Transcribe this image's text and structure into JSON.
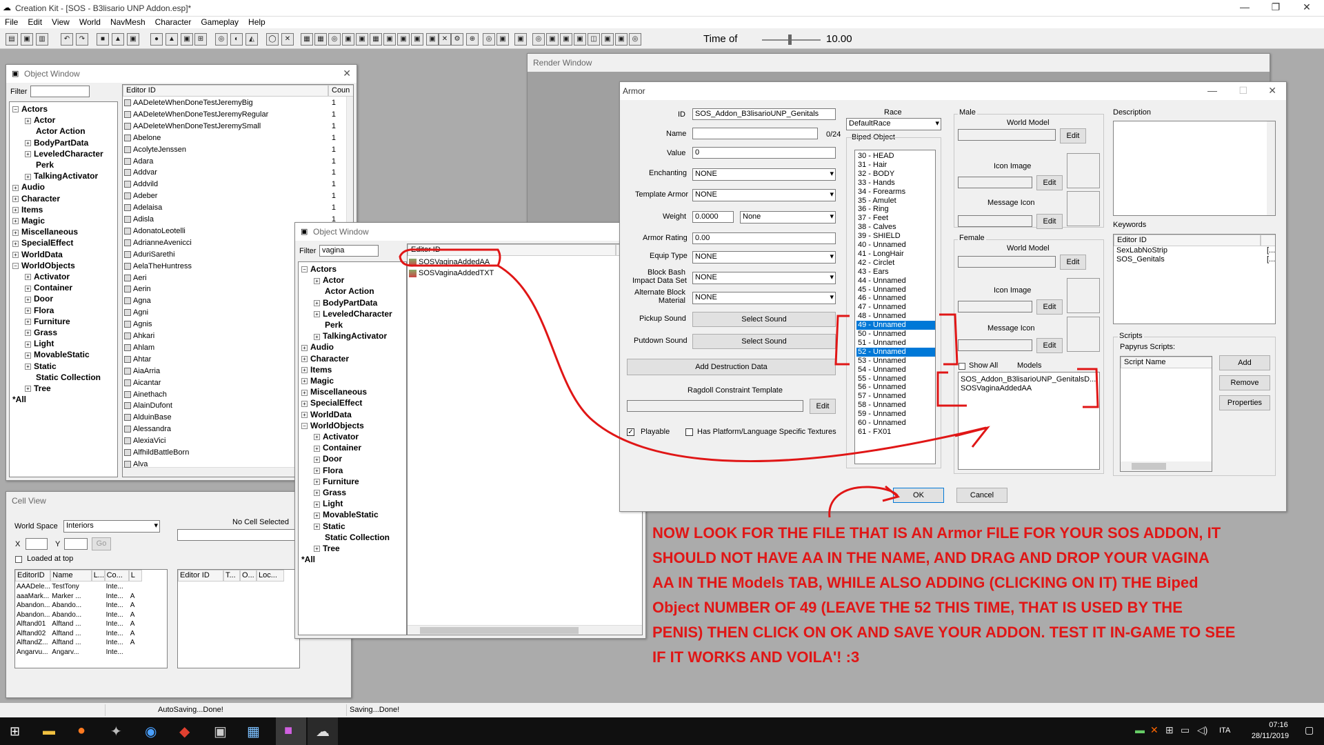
{
  "app": {
    "title": "Creation Kit - [SOS - B3lisario UNP Addon.esp]*",
    "menu": [
      "File",
      "Edit",
      "View",
      "World",
      "NavMesh",
      "Character",
      "Gameplay",
      "Help"
    ],
    "time_label": "Time of",
    "time_value": "10.00"
  },
  "object_window_1": {
    "title": "Object Window",
    "filter_label": "Filter",
    "filter_value": "",
    "col_editor_id": "Editor ID",
    "col_count": "Coun",
    "tree": [
      {
        "label": "Actors",
        "level": 0,
        "sign": "−"
      },
      {
        "label": "Actor",
        "level": 1,
        "sign": "+"
      },
      {
        "label": "Actor Action",
        "level": 1,
        "sign": ""
      },
      {
        "label": "BodyPartData",
        "level": 1,
        "sign": "+"
      },
      {
        "label": "LeveledCharacter",
        "level": 1,
        "sign": "+"
      },
      {
        "label": "Perk",
        "level": 1,
        "sign": ""
      },
      {
        "label": "TalkingActivator",
        "level": 1,
        "sign": "+"
      },
      {
        "label": "Audio",
        "level": 0,
        "sign": "+"
      },
      {
        "label": "Character",
        "level": 0,
        "sign": "+"
      },
      {
        "label": "Items",
        "level": 0,
        "sign": "+"
      },
      {
        "label": "Magic",
        "level": 0,
        "sign": "+"
      },
      {
        "label": "Miscellaneous",
        "level": 0,
        "sign": "+"
      },
      {
        "label": "SpecialEffect",
        "level": 0,
        "sign": "+"
      },
      {
        "label": "WorldData",
        "level": 0,
        "sign": "+"
      },
      {
        "label": "WorldObjects",
        "level": 0,
        "sign": "−"
      },
      {
        "label": "Activator",
        "level": 1,
        "sign": "+"
      },
      {
        "label": "Container",
        "level": 1,
        "sign": "+"
      },
      {
        "label": "Door",
        "level": 1,
        "sign": "+"
      },
      {
        "label": "Flora",
        "level": 1,
        "sign": "+"
      },
      {
        "label": "Furniture",
        "level": 1,
        "sign": "+"
      },
      {
        "label": "Grass",
        "level": 1,
        "sign": "+"
      },
      {
        "label": "Light",
        "level": 1,
        "sign": "+"
      },
      {
        "label": "MovableStatic",
        "level": 1,
        "sign": "+"
      },
      {
        "label": "Static",
        "level": 1,
        "sign": "+"
      },
      {
        "label": "Static Collection",
        "level": 1,
        "sign": ""
      },
      {
        "label": "Tree",
        "level": 1,
        "sign": "+"
      },
      {
        "label": "*All",
        "level": 0,
        "sign": ""
      }
    ],
    "items": [
      {
        "id": "AADeleteWhenDoneTestJeremyBig",
        "count": "1"
      },
      {
        "id": "AADeleteWhenDoneTestJeremyRegular",
        "count": "1"
      },
      {
        "id": "AADeleteWhenDoneTestJeremySmall",
        "count": "1"
      },
      {
        "id": "Abelone",
        "count": "1"
      },
      {
        "id": "AcolyteJenssen",
        "count": "1"
      },
      {
        "id": "Adara",
        "count": "1"
      },
      {
        "id": "Addvar",
        "count": "1"
      },
      {
        "id": "Addvild",
        "count": "1"
      },
      {
        "id": "Adeber",
        "count": "1"
      },
      {
        "id": "Adelaisa",
        "count": "1"
      },
      {
        "id": "Adisla",
        "count": "1"
      },
      {
        "id": "AdonatoLeotelli",
        "count": "1"
      },
      {
        "id": "AdrianneAvenicci",
        "count": "1"
      },
      {
        "id": "AduriSarethi",
        "count": "1"
      },
      {
        "id": "AelaTheHuntress",
        "count": "1"
      },
      {
        "id": "Aeri",
        "count": "1"
      },
      {
        "id": "Aerin",
        "count": "1"
      },
      {
        "id": "Agna",
        "count": "1"
      },
      {
        "id": "Agni",
        "count": "1"
      },
      {
        "id": "Agnis",
        "count": "1"
      },
      {
        "id": "Ahkari",
        "count": "1"
      },
      {
        "id": "Ahlam",
        "count": "1"
      },
      {
        "id": "Ahtar",
        "count": "1"
      },
      {
        "id": "AiaArria",
        "count": "1"
      },
      {
        "id": "Aicantar",
        "count": "1"
      },
      {
        "id": "Ainethach",
        "count": "1"
      },
      {
        "id": "AlainDufont",
        "count": "1"
      },
      {
        "id": "AlduinBase",
        "count": "1"
      },
      {
        "id": "Alessandra",
        "count": "1"
      },
      {
        "id": "AlexiaVici",
        "count": "1"
      },
      {
        "id": "AlfhildBattleBorn",
        "count": "1"
      },
      {
        "id": "Alva",
        "count": "1"
      }
    ]
  },
  "object_window_2": {
    "title": "Object Window",
    "filter_label": "Filter",
    "filter_value": "vagina",
    "col_editor_id": "Editor ID",
    "col_extra": "C",
    "tree": [
      {
        "label": "Actors",
        "level": 0,
        "sign": "−"
      },
      {
        "label": "Actor",
        "level": 1,
        "sign": "+"
      },
      {
        "label": "Actor Action",
        "level": 1,
        "sign": ""
      },
      {
        "label": "BodyPartData",
        "level": 1,
        "sign": "+"
      },
      {
        "label": "LeveledCharacter",
        "level": 1,
        "sign": "+"
      },
      {
        "label": "Perk",
        "level": 1,
        "sign": ""
      },
      {
        "label": "TalkingActivator",
        "level": 1,
        "sign": "+"
      },
      {
        "label": "Audio",
        "level": 0,
        "sign": "+"
      },
      {
        "label": "Character",
        "level": 0,
        "sign": "+"
      },
      {
        "label": "Items",
        "level": 0,
        "sign": "+"
      },
      {
        "label": "Magic",
        "level": 0,
        "sign": "+"
      },
      {
        "label": "Miscellaneous",
        "level": 0,
        "sign": "+"
      },
      {
        "label": "SpecialEffect",
        "level": 0,
        "sign": "+"
      },
      {
        "label": "WorldData",
        "level": 0,
        "sign": "+"
      },
      {
        "label": "WorldObjects",
        "level": 0,
        "sign": "−"
      },
      {
        "label": "Activator",
        "level": 1,
        "sign": "+"
      },
      {
        "label": "Container",
        "level": 1,
        "sign": "+"
      },
      {
        "label": "Door",
        "level": 1,
        "sign": "+"
      },
      {
        "label": "Flora",
        "level": 1,
        "sign": "+"
      },
      {
        "label": "Furniture",
        "level": 1,
        "sign": "+"
      },
      {
        "label": "Grass",
        "level": 1,
        "sign": "+"
      },
      {
        "label": "Light",
        "level": 1,
        "sign": "+"
      },
      {
        "label": "MovableStatic",
        "level": 1,
        "sign": "+"
      },
      {
        "label": "Static",
        "level": 1,
        "sign": "+"
      },
      {
        "label": "Static Collection",
        "level": 1,
        "sign": ""
      },
      {
        "label": "Tree",
        "level": 1,
        "sign": "+"
      },
      {
        "label": "*All",
        "level": 0,
        "sign": ""
      }
    ],
    "items": [
      "SOSVaginaAddedAA",
      "SOSVaginaAddedTXT"
    ]
  },
  "render_window": {
    "title": "Render Window"
  },
  "cell_view": {
    "title": "Cell View",
    "world_space_label": "World Space",
    "world_space_value": "Interiors",
    "no_cell": "No Cell Selected",
    "x_label": "X",
    "y_label": "Y",
    "go_label": "Go",
    "loaded_label": "Loaded at top",
    "left_cols": [
      "EditorID",
      "Name",
      "L...",
      "Co...",
      "L"
    ],
    "left_rows": [
      [
        "AAADele...",
        "TestTony",
        "",
        "Inte...",
        ""
      ],
      [
        "aaaMark...",
        "Marker ...",
        "",
        "Inte...",
        "A"
      ],
      [
        "Abandon...",
        "Abando...",
        "",
        "Inte...",
        "A"
      ],
      [
        "Abandon...",
        "Abando...",
        "",
        "Inte...",
        "A"
      ],
      [
        "Alftand01",
        "Alftand ...",
        "",
        "Inte...",
        "A"
      ],
      [
        "Alftand02",
        "Alftand ...",
        "",
        "Inte...",
        "A"
      ],
      [
        "AlftandZ...",
        "Alftand ...",
        "",
        "Inte...",
        "A"
      ],
      [
        "Angarvu...",
        "Angarv...",
        "",
        "Inte...",
        ""
      ]
    ],
    "right_cols": [
      "Editor ID",
      "T...",
      "O...",
      "Loc..."
    ]
  },
  "armor_dialog": {
    "title": "Armor",
    "id_label": "ID",
    "id_value": "SOS_Addon_B3lisarioUNP_Genitals",
    "name_label": "Name",
    "name_value": "",
    "name_count": "0/24",
    "value_label": "Value",
    "value_value": "0",
    "enchanting_label": "Enchanting",
    "enchanting_value": "NONE",
    "template_label": "Template Armor",
    "template_value": "NONE",
    "weight_label": "Weight",
    "weight_value": "0.0000",
    "weight_type": "None",
    "armor_rating_label": "Armor Rating",
    "armor_rating_value": "0.00",
    "equip_type_label": "Equip Type",
    "equip_type_value": "NONE",
    "block_bash_label_1": "Block Bash",
    "block_bash_label_2": "Impact Data Set",
    "block_bash_value": "NONE",
    "alt_block_label_1": "Alternate Block",
    "alt_block_label_2": "Material",
    "alt_block_value": "NONE",
    "pickup_label": "Pickup Sound",
    "putdown_label": "Putdown Sound",
    "select_sound": "Select Sound",
    "add_destruction": "Add Destruction Data",
    "ragdoll_label": "Ragdoll Constraint Template",
    "edit_label": "Edit",
    "playable_label": "Playable",
    "platform_label": "Has Platform/Language Specific Textures",
    "race_label": "Race",
    "race_value": "DefaultRace",
    "biped_label": "Biped Object",
    "biped_items": [
      {
        "label": "30 - HEAD",
        "sel": false
      },
      {
        "label": "31 - Hair",
        "sel": false
      },
      {
        "label": "32 - BODY",
        "sel": false
      },
      {
        "label": "33 - Hands",
        "sel": false
      },
      {
        "label": "34 - Forearms",
        "sel": false
      },
      {
        "label": "35 - Amulet",
        "sel": false
      },
      {
        "label": "36 - Ring",
        "sel": false
      },
      {
        "label": "37 - Feet",
        "sel": false
      },
      {
        "label": "38 - Calves",
        "sel": false
      },
      {
        "label": "39 - SHIELD",
        "sel": false
      },
      {
        "label": "40 - Unnamed",
        "sel": false
      },
      {
        "label": "41 - LongHair",
        "sel": false
      },
      {
        "label": "42 - Circlet",
        "sel": false
      },
      {
        "label": "43 - Ears",
        "sel": false
      },
      {
        "label": "44 - Unnamed",
        "sel": false
      },
      {
        "label": "45 - Unnamed",
        "sel": false
      },
      {
        "label": "46 - Unnamed",
        "sel": false
      },
      {
        "label": "47 - Unnamed",
        "sel": false
      },
      {
        "label": "48 - Unnamed",
        "sel": false
      },
      {
        "label": "49 - Unnamed",
        "sel": true
      },
      {
        "label": "50 - Unnamed",
        "sel": false
      },
      {
        "label": "51 - Unnamed",
        "sel": false
      },
      {
        "label": "52 - Unnamed",
        "sel": true
      },
      {
        "label": "53 - Unnamed",
        "sel": false
      },
      {
        "label": "54 - Unnamed",
        "sel": false
      },
      {
        "label": "55 - Unnamed",
        "sel": false
      },
      {
        "label": "56 - Unnamed",
        "sel": false
      },
      {
        "label": "57 - Unnamed",
        "sel": false
      },
      {
        "label": "58 - Unnamed",
        "sel": false
      },
      {
        "label": "59 - Unnamed",
        "sel": false
      },
      {
        "label": "60 - Unnamed",
        "sel": false
      },
      {
        "label": "61 - FX01",
        "sel": false
      }
    ],
    "male_label": "Male",
    "female_label": "Female",
    "world_model_label": "World Model",
    "icon_image_label": "Icon Image",
    "message_icon_label": "Message Icon",
    "show_all_label": "Show All",
    "models_label": "Models",
    "models_items": [
      "SOS_Addon_B3lisarioUNP_GenitalsD...",
      "SOSVaginaAddedAA"
    ],
    "description_label": "Description",
    "keywords_label": "Keywords",
    "keywords_col": "Editor ID",
    "keywords": [
      "SexLabNoStrip",
      "SOS_Genitals"
    ],
    "scripts_label": "Scripts",
    "papyrus_label": "Papyrus Scripts:",
    "script_name_col": "Script Name",
    "add_btn": "Add",
    "remove_btn": "Remove",
    "properties_btn": "Properties",
    "ok_btn": "OK",
    "cancel_btn": "Cancel"
  },
  "annotation": {
    "lines": [
      "NOW LOOK FOR THE FILE THAT IS AN  Armor  FILE FOR YOUR SOS ADDON, IT",
      "SHOULD NOT HAVE AA IN THE NAME, AND DRAG AND DROP YOUR VAGINA",
      "AA IN THE  Models  TAB, WHILE ALSO ADDING (CLICKING ON IT) THE  Biped",
      "Object  NUMBER OF 49 (LEAVE THE 52 THIS TIME, THAT IS USED BY THE",
      "PENIS) THEN CLICK ON OK AND SAVE YOUR ADDON. TEST IT IN-GAME TO SEE",
      "IF IT WORKS AND VOILA'! :3"
    ],
    "color": "#e01616"
  },
  "status": {
    "left": "AutoSaving...Done!",
    "right": "Saving...Done!"
  },
  "taskbar": {
    "lang": "ITA",
    "time": "07:16",
    "date": "28/11/2019"
  }
}
